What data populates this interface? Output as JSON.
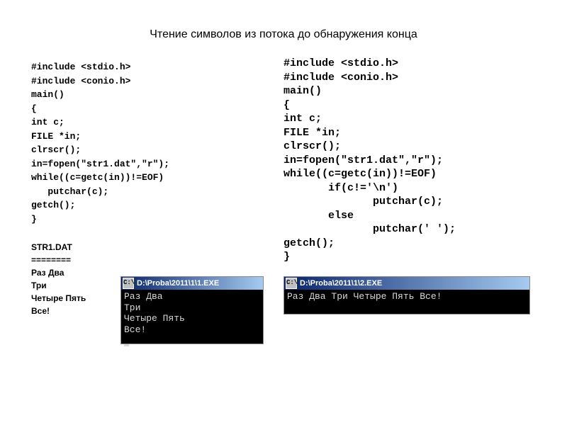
{
  "title": "Чтение символов из потока до обнаружения конца",
  "code_left": "#include <stdio.h>\n#include <conio.h>\nmain()\n{\nint c;\nFILE *in;\nclrscr();\nin=fopen(\"str1.dat\",\"r\");\nwhile((c=getc(in))!=EOF)\n   putchar(c);\ngetch();\n}",
  "str1": "STR1.DAT\n========\nРаз Два\nТри\nЧетыре Пять\nВсе!",
  "code_right": "#include <stdio.h>\n#include <conio.h>\nmain()\n{\nint c;\nFILE *in;\nclrscr();\nin=fopen(\"str1.dat\",\"r\");\nwhile((c=getc(in))!=EOF)\n       if(c!='\\n')\n              putchar(c);\n       else\n              putchar(' ');\ngetch();\n}",
  "console1": {
    "icon": "C:\\",
    "title": "D:\\Proba\\2011\\1\\1.EXE",
    "output": "Раз Два\nТри\nЧетыре Пять\nВсе!"
  },
  "console2": {
    "icon": "C:\\",
    "title": "D:\\Proba\\2011\\1\\2.EXE",
    "output": "Раз Два Три Четыре Пять Все!"
  }
}
